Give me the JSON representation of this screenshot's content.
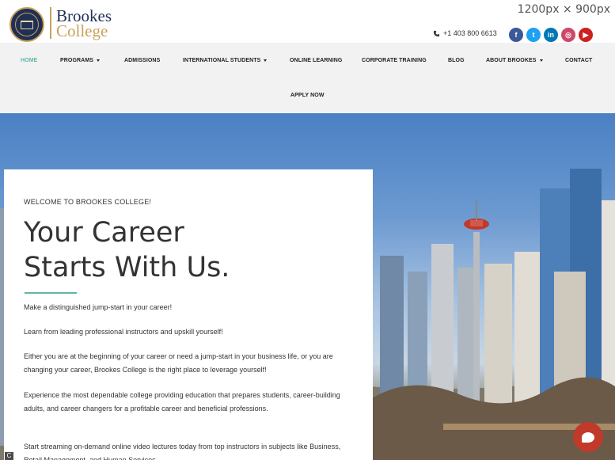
{
  "brand": {
    "line1": "Brookes",
    "line2": "College"
  },
  "viewport_note": "1200px × 900px",
  "contact": {
    "phone": "+1 403 800 6613"
  },
  "socials": [
    {
      "icon": "facebook-icon",
      "glyph": "f",
      "color": "#3b5998"
    },
    {
      "icon": "twitter-icon",
      "glyph": "t",
      "color": "#1da1f2"
    },
    {
      "icon": "linkedin-icon",
      "glyph": "in",
      "color": "#0077b5"
    },
    {
      "icon": "instagram-icon",
      "glyph": "◎",
      "color": "#cd486b"
    },
    {
      "icon": "youtube-icon",
      "glyph": "▶",
      "color": "#cd201f"
    }
  ],
  "nav": {
    "home": "HOME",
    "programs": "PROGRAMS",
    "admissions": "ADMISSIONS",
    "international": "INTERNATIONAL STUDENTS",
    "online": "ONLINE LEARNING",
    "corporate": "CORPORATE TRAINING",
    "blog": "BLOG",
    "about": "ABOUT BROOKES",
    "contact": "CONTACT",
    "apply": "APPLY NOW"
  },
  "hero": {
    "welcome": "WELCOME TO BROOKES COLLEGE!",
    "title_line1": "Your Career",
    "title_line2": "Starts With Us.",
    "p1": "Make a distinguished jump-start in your career!",
    "p2": " Learn from leading professional instructors and upskill yourself!",
    "p3": " Either you are at the beginning of your career or need a jump-start in your business life, or you are changing your career, Brookes College is the right place to leverage yourself!",
    "p4": " Experience the most dependable college providing education that prepares students, career-building adults, and career changers for a profitable career and beneficial professions.",
    "p5": " Start streaming on-demand online video lectures today from top instructors in subjects like Business, Retail Management, and Human Services."
  },
  "colors": {
    "accent": "#5fb6a6",
    "navy": "#1f2f55",
    "gold": "#c9a25a"
  }
}
